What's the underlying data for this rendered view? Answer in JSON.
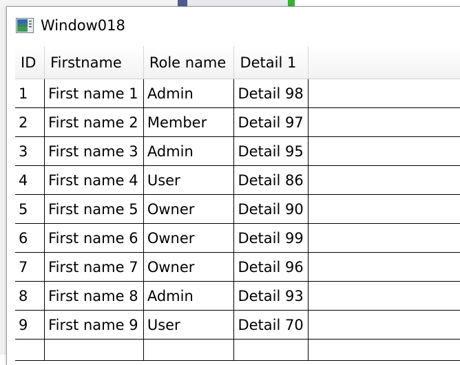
{
  "window": {
    "title": "Window018",
    "icon": "wpf-window-icon"
  },
  "grid": {
    "columns": [
      "ID",
      "Firstname",
      "Role name",
      "Detail 1"
    ],
    "rows": [
      {
        "id": "1",
        "firstname": "First name 1",
        "role": "Admin",
        "detail": "Detail 98"
      },
      {
        "id": "2",
        "firstname": "First name 2",
        "role": "Member",
        "detail": "Detail 97"
      },
      {
        "id": "3",
        "firstname": "First name 3",
        "role": "Admin",
        "detail": "Detail 95"
      },
      {
        "id": "4",
        "firstname": "First name 4",
        "role": "User",
        "detail": "Detail 86"
      },
      {
        "id": "5",
        "firstname": "First name 5",
        "role": "Owner",
        "detail": "Detail 90"
      },
      {
        "id": "6",
        "firstname": "First name 6",
        "role": "Owner",
        "detail": "Detail 99"
      },
      {
        "id": "7",
        "firstname": "First name 7",
        "role": "Owner",
        "detail": "Detail 96"
      },
      {
        "id": "8",
        "firstname": "First name 8",
        "role": "Admin",
        "detail": "Detail 93"
      },
      {
        "id": "9",
        "firstname": "First name 9",
        "role": "User",
        "detail": "Detail 70"
      }
    ]
  }
}
